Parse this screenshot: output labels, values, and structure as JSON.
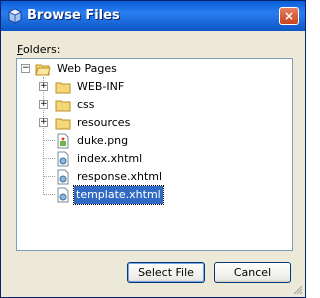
{
  "window": {
    "title": "Browse Files",
    "close_glyph": "×",
    "icon": "app-cube-icon"
  },
  "folders_label": {
    "mnemonic": "F",
    "rest": "olders:"
  },
  "tree": {
    "root": {
      "label": "Web Pages",
      "icon": "folder-open-icon",
      "expander": "−"
    },
    "items": [
      {
        "label": "WEB-INF",
        "icon": "folder-icon",
        "expander": "+"
      },
      {
        "label": "css",
        "icon": "folder-icon",
        "expander": "+"
      },
      {
        "label": "resources",
        "icon": "folder-icon",
        "expander": "+"
      },
      {
        "label": "duke.png",
        "icon": "image-file-icon",
        "expander": ""
      },
      {
        "label": "index.xhtml",
        "icon": "xhtml-file-icon",
        "expander": ""
      },
      {
        "label": "response.xhtml",
        "icon": "xhtml-file-icon",
        "expander": ""
      },
      {
        "label": "template.xhtml",
        "icon": "xhtml-file-icon",
        "expander": "",
        "selected": true
      }
    ]
  },
  "buttons": {
    "select": "Select File",
    "cancel": "Cancel"
  },
  "colors": {
    "selection": "#316ac5",
    "titlebar": "#0a5fd8",
    "dialog_bg": "#ece9d8"
  }
}
